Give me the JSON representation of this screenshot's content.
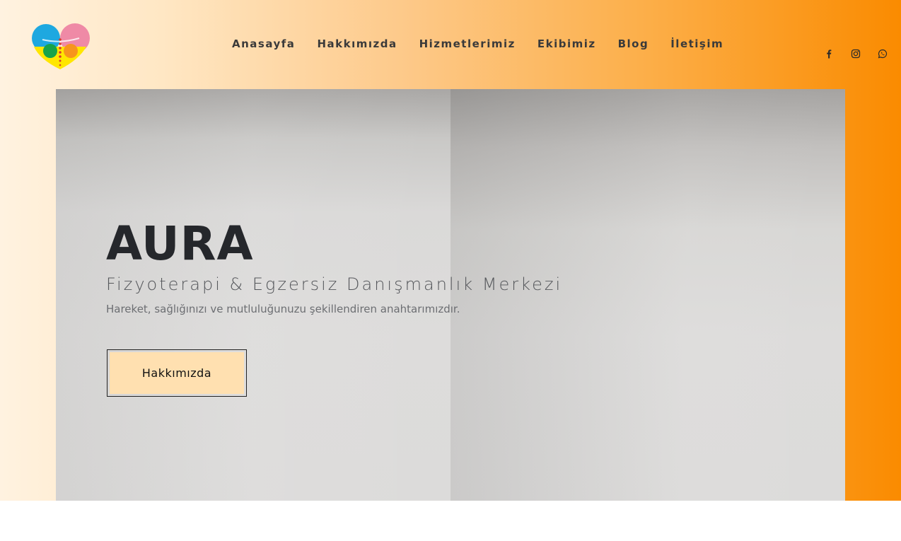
{
  "brand": {
    "logo_icon": "aura-heart-logo-icon",
    "colors": {
      "blue": "#1ea8e0",
      "pink": "#ef8aa6",
      "green": "#17a34a",
      "orange": "#f7941d",
      "yellow": "#ffe600",
      "spine": "#d93a2b"
    }
  },
  "nav": {
    "items": [
      {
        "label": "Anasayfa"
      },
      {
        "label": "Hakkımızda"
      },
      {
        "label": "Hizmetlerimiz"
      },
      {
        "label": "Ekibimiz"
      },
      {
        "label": "Blog"
      },
      {
        "label": "İletişim"
      }
    ]
  },
  "social": {
    "icons": [
      "facebook-icon",
      "instagram-icon",
      "whatsapp-icon"
    ]
  },
  "hero": {
    "title": "AURA",
    "subtitle": "Fizyoterapi & Egzersiz Danışmanlık Merkezi",
    "tagline": "Hareket, sağlığınızı ve mutluluğunuzu şekillendiren anahtarımızdır.",
    "button_label": "Hakkımızda"
  },
  "theme": {
    "gradient_start": "#fff2e0",
    "gradient_end": "#fa8b00",
    "button_fill": "#ffe0b0",
    "text_dark": "#25272b"
  }
}
